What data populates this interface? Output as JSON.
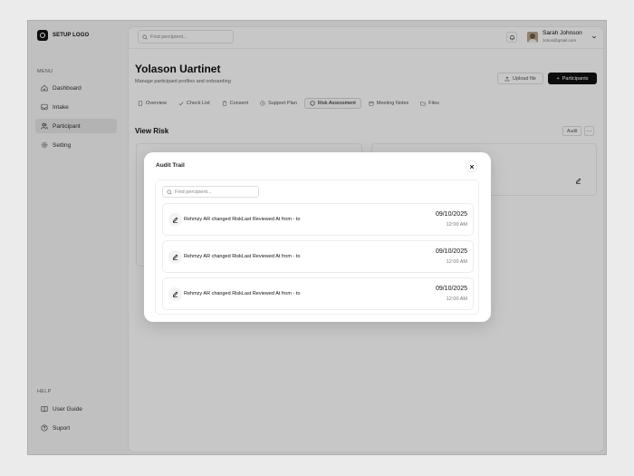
{
  "app": {
    "logo_text": "SETUP LOGO"
  },
  "sidebar": {
    "menu_label": "MENU",
    "items": [
      {
        "label": "Dashboard",
        "icon": "home-icon"
      },
      {
        "label": "Intake",
        "icon": "inbox-icon"
      },
      {
        "label": "Participant",
        "icon": "users-icon",
        "active": true
      },
      {
        "label": "Setting",
        "icon": "gear-icon"
      }
    ],
    "help_label": "HELP",
    "help_items": [
      {
        "label": "User Guide",
        "icon": "book-icon"
      },
      {
        "label": "Suport",
        "icon": "help-icon"
      }
    ]
  },
  "header": {
    "search_placeholder": "Find percipient...",
    "user": {
      "name": "Sarah Johnson",
      "email": "Jolros@gmail.com"
    }
  },
  "page": {
    "title": "Yolason Uartinet",
    "subtitle": "Manage participant profiles and onboarding",
    "upload_label": "Upload file",
    "participants_label": "Participants",
    "tabs": [
      {
        "label": "Overview"
      },
      {
        "label": "Check List"
      },
      {
        "label": "Consent"
      },
      {
        "label": "Support Plan"
      },
      {
        "label": "Risk Assessment",
        "active": true
      },
      {
        "label": "Meeting Notes"
      },
      {
        "label": "Files"
      }
    ],
    "section_title": "View Risk",
    "audit_label": "Audit",
    "more_label": "···"
  },
  "modal": {
    "title": "Audit Trail",
    "search_placeholder": "Find percipient...",
    "entries": [
      {
        "text": "Rehmzy AR changed RiskLast Reviewed At from - to",
        "date": "09/10/2025",
        "time": "12:00 AM"
      },
      {
        "text": "Rehmzy AR changed RiskLast Reviewed At from - to",
        "date": "09/10/2025",
        "time": "12:00 AM"
      },
      {
        "text": "Rehmzy AR changed RiskLast Reviewed At from - to",
        "date": "09/10/2025",
        "time": "12:00 AM"
      }
    ]
  }
}
